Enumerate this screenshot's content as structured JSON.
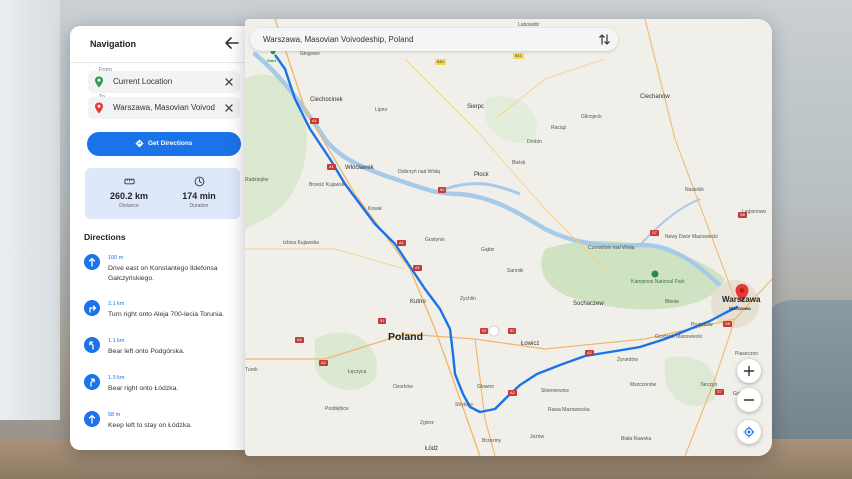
{
  "panel": {
    "title": "Navigation",
    "from_caption": "From",
    "from_value": "Current Location",
    "to_caption": "To",
    "to_value": "Warszawa, Masovian Voivod",
    "get_directions": "Get Directions"
  },
  "summary": {
    "distance": "260.2 km",
    "distance_label": "Distance",
    "duration": "174 min",
    "duration_label": "Duration"
  },
  "directions": {
    "heading": "Directions",
    "steps": [
      {
        "distance": "100 m",
        "text": "Drive east on Konstantego Ildefonsa Gałczyńskiego.",
        "icon": "arrow-up-icon"
      },
      {
        "distance": "2.1 km",
        "text": "Turn right onto Aleja 700-lecia Torunia.",
        "icon": "turn-right-icon"
      },
      {
        "distance": "1.1 km",
        "text": "Bear left onto Podgórska.",
        "icon": "bear-left-icon"
      },
      {
        "distance": "1.3 km",
        "text": "Bear right onto Łódzka.",
        "icon": "bear-right-icon"
      },
      {
        "distance": "58 m",
        "text": "Keep left to stay on Łódzka.",
        "icon": "keep-left-icon"
      }
    ]
  },
  "map": {
    "search_text": "Warszawa, Masovian Voivodeship, Poland",
    "start_label": "Start",
    "country_label": "Poland",
    "destination_label": "Warszawa",
    "destination_sublabel": "Warszawa",
    "park_label": "Kampinos National Park",
    "places": {
      "lubowidz": "Lubowidz",
      "glogowo": "Głogowo",
      "ciechocinek": "Ciechocinek",
      "lipno": "Lipno",
      "sierpc": "Sierpc",
      "plonsk_none": "",
      "wloclawek": "Włocławek",
      "dobrzyn": "Dobrzyń nad Wisłą",
      "drobin": "Drobin",
      "raciaz": "Raciąż",
      "glinojeck": "Glinojeck",
      "ciechanow": "Ciechanów",
      "bielsk": "Bielsk",
      "radziejow": "Radziejów",
      "brzesc": "Brześć Kujawski",
      "kowal": "Kowal",
      "plock": "Płock",
      "nasielsk": "Nasielsk",
      "izbica": "Izbica Kujawska",
      "gostynin": "Gostynin",
      "gabin": "Gąbin",
      "czerwinsk": "Czerwińsk nad Wisłą",
      "nowy_dwor": "Nowy Dwór Mazowiecki",
      "legionowo": "Legionowo",
      "sanniki": "Sanniki",
      "kutno": "Kutno",
      "zychlin": "Żychlin",
      "sochaczew": "Sochaczew",
      "lowicz": "Łowicz",
      "blonie": "Błonie",
      "pruszkow": "Pruszków",
      "piaseczno": "Piaseczno",
      "grodzisk": "Grodzisk Mazowiecki",
      "zyrardow": "Żyrardów",
      "turek": "Turek",
      "leczyca": "Łęczyca",
      "ozorkow": "Ozorków",
      "glowno": "Głowno",
      "skierniewice": "Skierniewice",
      "mszczonow": "Mszczonów",
      "tarczyn": "Tarczyn",
      "grojec": "Grójec",
      "poddebice": "Poddębice",
      "zgierz": "Zgierz",
      "stryk": "Stryków",
      "brzeziny": "Brzeziny",
      "jezow": "Jeżów",
      "rawa": "Rawa Mazowiecka",
      "biala": "Biała Rawska",
      "lodz": "Łódź",
      "rzgow_none": "",
      "mogilno_none": "",
      "ciechocin_none": ""
    },
    "roads": [
      "S10",
      "S41",
      "S10",
      "A1",
      "A1",
      "62",
      "91",
      "A1",
      "A2",
      "92",
      "92",
      "A2",
      "S8",
      "S7",
      "S7",
      "S7",
      "S2",
      "A2",
      "A1",
      "S50",
      "S8",
      "50",
      "S8",
      "S7",
      "S8",
      "S8",
      "S8"
    ]
  },
  "colors": {
    "accent": "#1a73e8",
    "route": "#1a73e8",
    "pin_green": "#2e9d4f",
    "pin_red": "#e53935"
  }
}
